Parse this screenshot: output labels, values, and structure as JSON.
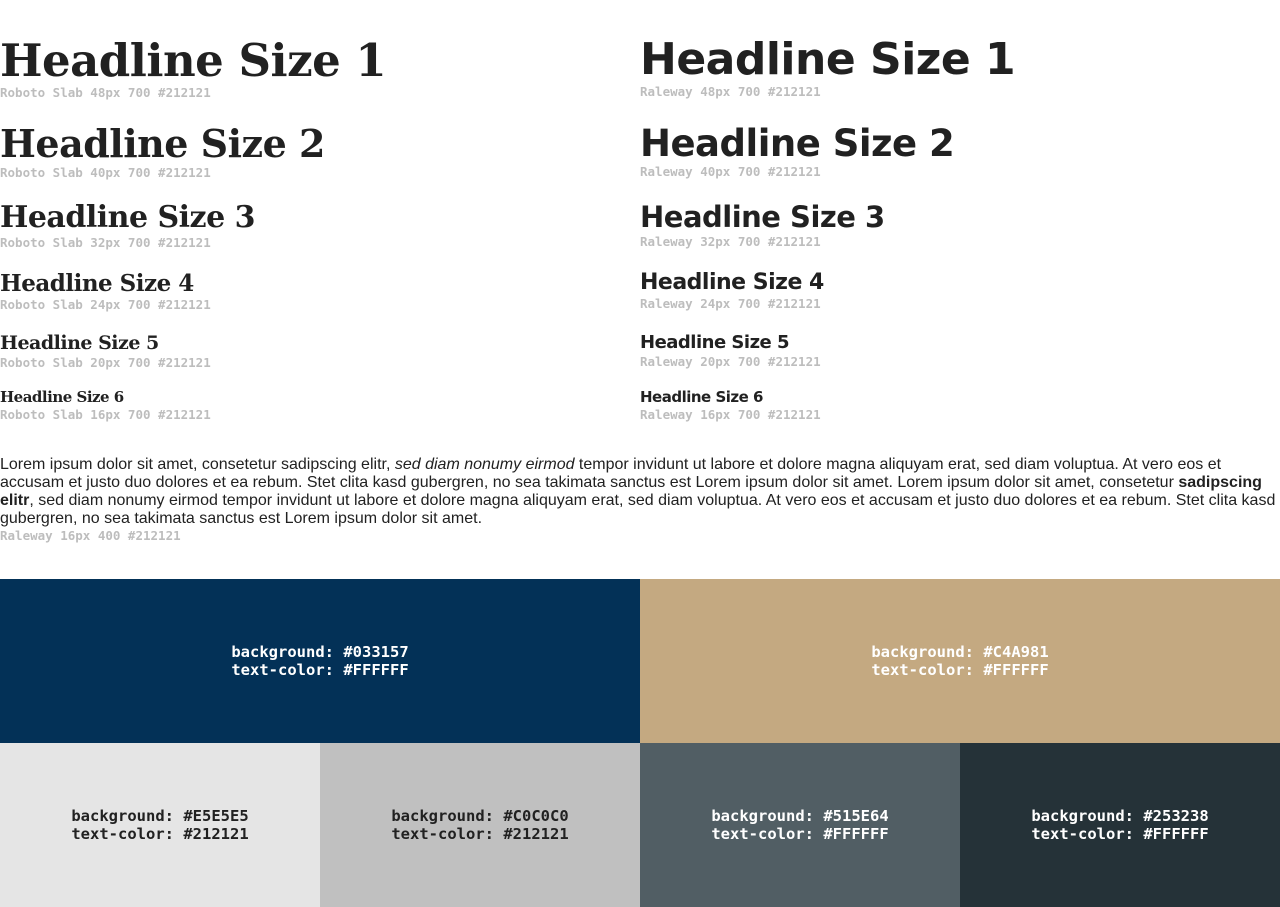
{
  "left": {
    "headings": [
      {
        "text": "Headline Size 1",
        "spec": "Roboto Slab 48px 700 #212121"
      },
      {
        "text": "Headline Size 2",
        "spec": "Roboto Slab 40px 700 #212121"
      },
      {
        "text": "Headline Size 3",
        "spec": "Roboto Slab 32px 700 #212121"
      },
      {
        "text": "Headline Size 4",
        "spec": "Roboto Slab 24px 700 #212121"
      },
      {
        "text": "Headline Size 5",
        "spec": "Roboto Slab 20px 700 #212121"
      },
      {
        "text": "Headline Size 6",
        "spec": "Roboto Slab 16px 700 #212121"
      }
    ]
  },
  "right": {
    "headings": [
      {
        "text": "Headline Size 1",
        "spec": "Raleway 48px 700 #212121"
      },
      {
        "text": "Headline Size 2",
        "spec": "Raleway 40px 700 #212121"
      },
      {
        "text": "Headline Size 3",
        "spec": "Raleway 32px 700 #212121"
      },
      {
        "text": "Headline Size 4",
        "spec": "Raleway 24px 700 #212121"
      },
      {
        "text": "Headline Size 5",
        "spec": "Raleway 20px 700 #212121"
      },
      {
        "text": "Headline Size 6",
        "spec": "Raleway 16px 700 #212121"
      }
    ]
  },
  "paragraph": {
    "part1": "Lorem ipsum dolor sit amet, consetetur sadipscing elitr, ",
    "italic": "sed diam nonumy eirmod",
    "part2": " tempor invidunt ut labore et dolore magna aliquyam erat, sed diam voluptua. At vero eos et accusam et justo duo dolores et ea rebum. Stet clita kasd gubergren, no sea takimata sanctus est Lorem ipsum dolor sit amet. Lorem ipsum dolor sit amet, consetetur ",
    "bold": "sadipscing elitr",
    "part3": ", sed diam nonumy eirmod tempor invidunt ut labore et dolore magna aliquyam erat, sed diam voluptua. At vero eos et accusam et justo duo dolores et ea rebum. Stet clita kasd gubergren, no sea takimata sanctus est Lorem ipsum dolor sit amet.",
    "spec": "Raleway 16px 400 #212121"
  },
  "swatches": [
    {
      "bg_label": "background: #033157",
      "text_label": "text-color: #FFFFFF",
      "bg": "#033157",
      "fg": "#FFFFFF"
    },
    {
      "bg_label": "background: #C4A981",
      "text_label": "text-color: #FFFFFF",
      "bg": "#C4A981",
      "fg": "#FFFFFF"
    },
    {
      "bg_label": "background: #E5E5E5",
      "text_label": "text-color: #212121",
      "bg": "#E5E5E5",
      "fg": "#212121"
    },
    {
      "bg_label": "background: #C0C0C0",
      "text_label": "text-color: #212121",
      "bg": "#C0C0C0",
      "fg": "#212121"
    },
    {
      "bg_label": "background: #515E64",
      "text_label": "text-color: #FFFFFF",
      "bg": "#515E64",
      "fg": "#FFFFFF"
    },
    {
      "bg_label": "background: #253238",
      "text_label": "text-color: #FFFFFF",
      "bg": "#253238",
      "fg": "#FFFFFF"
    }
  ]
}
